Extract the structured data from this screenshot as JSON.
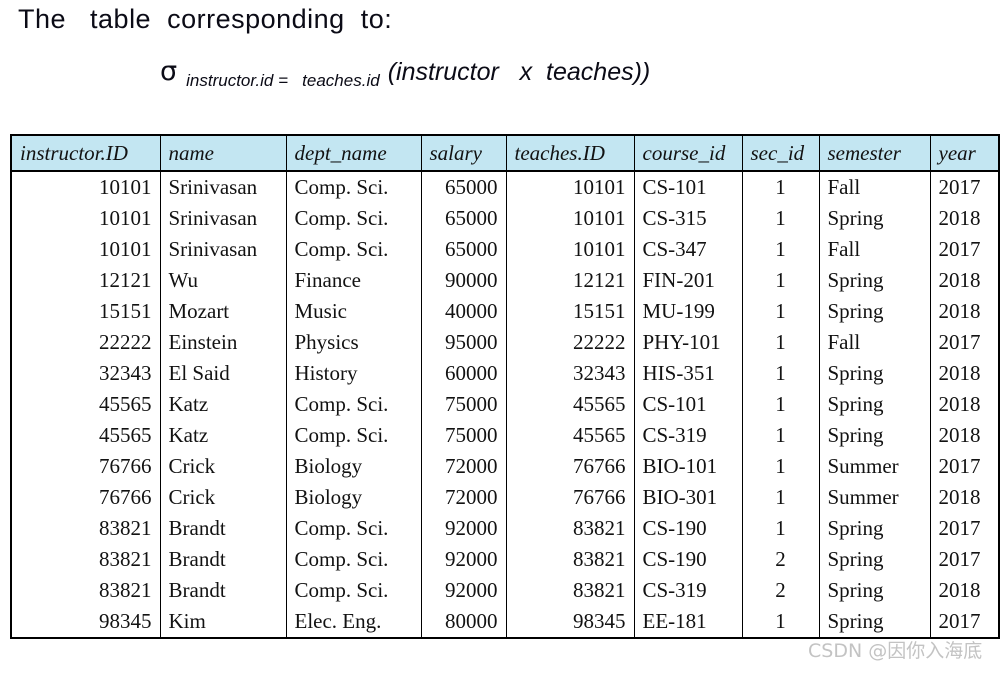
{
  "heading": {
    "text": "The   table  corresponding  to:"
  },
  "formula": {
    "operator": "σ",
    "subscript": "instructor.id =   teaches.id",
    "expression": "(instructor   x  teaches))"
  },
  "table": {
    "columns": [
      {
        "key": "instructor_id",
        "label": "instructor.ID",
        "align": "num"
      },
      {
        "key": "name",
        "label": "name",
        "align": "lft"
      },
      {
        "key": "dept_name",
        "label": "dept_name",
        "align": "lft"
      },
      {
        "key": "salary",
        "label": "salary",
        "align": "num"
      },
      {
        "key": "teaches_id",
        "label": "teaches.ID",
        "align": "num"
      },
      {
        "key": "course_id",
        "label": "course_id",
        "align": "lft"
      },
      {
        "key": "sec_id",
        "label": "sec_id",
        "align": "ctr"
      },
      {
        "key": "semester",
        "label": "semester",
        "align": "lft"
      },
      {
        "key": "year",
        "label": "year",
        "align": "lft"
      }
    ],
    "header_bg": "#c3e6f2",
    "rows": [
      [
        "10101",
        "Srinivasan",
        "Comp. Sci.",
        "65000",
        "10101",
        "CS-101",
        "1",
        "Fall",
        "2017"
      ],
      [
        "10101",
        "Srinivasan",
        "Comp. Sci.",
        "65000",
        "10101",
        "CS-315",
        "1",
        "Spring",
        "2018"
      ],
      [
        "10101",
        "Srinivasan",
        "Comp. Sci.",
        "65000",
        "10101",
        "CS-347",
        "1",
        "Fall",
        "2017"
      ],
      [
        "12121",
        "Wu",
        "Finance",
        "90000",
        "12121",
        "FIN-201",
        "1",
        "Spring",
        "2018"
      ],
      [
        "15151",
        "Mozart",
        "Music",
        "40000",
        "15151",
        "MU-199",
        "1",
        "Spring",
        "2018"
      ],
      [
        "22222",
        "Einstein",
        "Physics",
        "95000",
        "22222",
        "PHY-101",
        "1",
        "Fall",
        "2017"
      ],
      [
        "32343",
        "El Said",
        "History",
        "60000",
        "32343",
        "HIS-351",
        "1",
        "Spring",
        "2018"
      ],
      [
        "45565",
        "Katz",
        "Comp. Sci.",
        "75000",
        "45565",
        "CS-101",
        "1",
        "Spring",
        "2018"
      ],
      [
        "45565",
        "Katz",
        "Comp. Sci.",
        "75000",
        "45565",
        "CS-319",
        "1",
        "Spring",
        "2018"
      ],
      [
        "76766",
        "Crick",
        "Biology",
        "72000",
        "76766",
        "BIO-101",
        "1",
        "Summer",
        "2017"
      ],
      [
        "76766",
        "Crick",
        "Biology",
        "72000",
        "76766",
        "BIO-301",
        "1",
        "Summer",
        "2018"
      ],
      [
        "83821",
        "Brandt",
        "Comp. Sci.",
        "92000",
        "83821",
        "CS-190",
        "1",
        "Spring",
        "2017"
      ],
      [
        "83821",
        "Brandt",
        "Comp. Sci.",
        "92000",
        "83821",
        "CS-190",
        "2",
        "Spring",
        "2017"
      ],
      [
        "83821",
        "Brandt",
        "Comp. Sci.",
        "92000",
        "83821",
        "CS-319",
        "2",
        "Spring",
        "2018"
      ],
      [
        "98345",
        "Kim",
        "Elec. Eng.",
        "80000",
        "98345",
        "EE-181",
        "1",
        "Spring",
        "2017"
      ]
    ]
  },
  "watermark": {
    "text": "CSDN @因你入海底",
    "color": "#b9b9b9"
  }
}
